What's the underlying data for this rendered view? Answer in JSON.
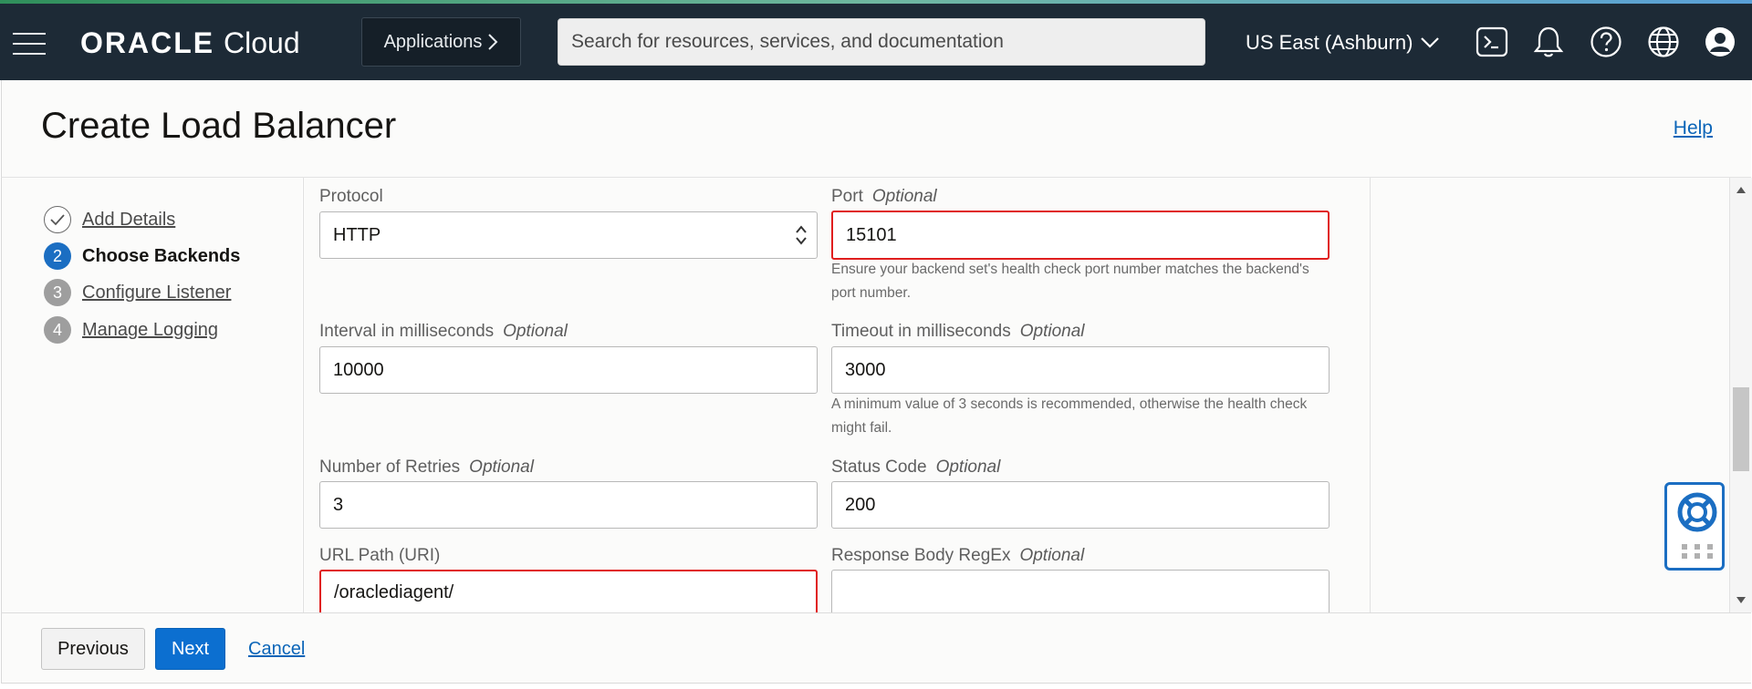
{
  "topbar": {
    "logo_brand": "ORACLE",
    "logo_product": "Cloud",
    "applications_label": "Applications",
    "search_placeholder": "Search for resources, services, and documentation",
    "region_label": "US East (Ashburn)",
    "icons": [
      "hamburger-menu-icon",
      "cloud-shell-icon",
      "bell-icon",
      "help-icon",
      "globe-icon",
      "user-avatar-icon"
    ]
  },
  "header": {
    "title": "Create Load Balancer",
    "help_label": "Help"
  },
  "steps": [
    {
      "number": "",
      "label": "Add Details",
      "state": "complete"
    },
    {
      "number": "2",
      "label": "Choose Backends",
      "state": "current"
    },
    {
      "number": "3",
      "label": "Configure Listener",
      "state": "upcoming"
    },
    {
      "number": "4",
      "label": "Manage Logging",
      "state": "upcoming"
    }
  ],
  "form": {
    "protocol": {
      "label": "Protocol",
      "value": "HTTP"
    },
    "port": {
      "label": "Port",
      "optional": "Optional",
      "value": "15101",
      "hint": "Ensure your backend set's health check port number matches the backend's port number."
    },
    "interval": {
      "label": "Interval in milliseconds",
      "optional": "Optional",
      "value": "10000"
    },
    "timeout": {
      "label": "Timeout in milliseconds",
      "optional": "Optional",
      "value": "3000",
      "hint": "A minimum value of 3 seconds is recommended, otherwise the health check might fail."
    },
    "retries": {
      "label": "Number of Retries",
      "optional": "Optional",
      "value": "3"
    },
    "status_code": {
      "label": "Status Code",
      "optional": "Optional",
      "value": "200"
    },
    "url_path": {
      "label": "URL Path (URI)",
      "value": "/oraclediagent/"
    },
    "response_regex": {
      "label": "Response Body RegEx",
      "optional": "Optional",
      "value": ""
    }
  },
  "footer": {
    "previous_label": "Previous",
    "next_label": "Next",
    "cancel_label": "Cancel"
  },
  "colors": {
    "topbar_bg": "#1d2a36",
    "accent_blue": "#0c6fd0",
    "error_red": "#e01e1e",
    "step_complete": "#ffffff",
    "step_upcoming": "#9e9e9e"
  }
}
